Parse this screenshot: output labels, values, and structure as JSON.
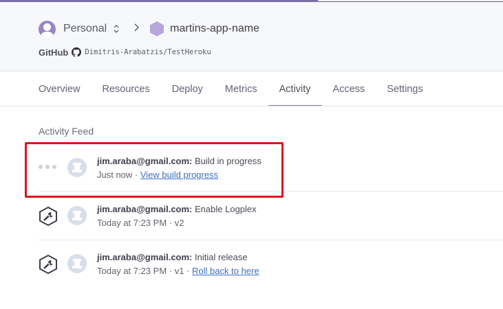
{
  "header": {
    "account": "Personal",
    "app_name": "martins-app-name",
    "github_label": "GitHub",
    "github_repo": "Dimitris-Arabatzis/TestHeroku"
  },
  "tabs": [
    {
      "label": "Overview"
    },
    {
      "label": "Resources"
    },
    {
      "label": "Deploy"
    },
    {
      "label": "Metrics"
    },
    {
      "label": "Activity",
      "active": true
    },
    {
      "label": "Access"
    },
    {
      "label": "Settings"
    }
  ],
  "feed": {
    "title": "Activity Feed",
    "items": [
      {
        "user": "jim.araba@gmail.com:",
        "action": "Build in progress",
        "time": "Just now",
        "separator": " · ",
        "link": "View build progress",
        "status": "in-progress"
      },
      {
        "user": "jim.araba@gmail.com:",
        "action": "Enable Logplex",
        "time": "Today at 7:23 PM",
        "separator": " · ",
        "version": "v2"
      },
      {
        "user": "jim.araba@gmail.com:",
        "action": "Initial release",
        "time": "Today at 7:23 PM",
        "separator": " · ",
        "version": "v1",
        "separator2": " · ",
        "link": "Roll back to here"
      }
    ]
  },
  "colors": {
    "accent": "#7d6fa3",
    "highlight": "#e0121e",
    "link": "#3b6fc3"
  },
  "icons": [
    "personal-avatar-icon",
    "updown-chevron-icon",
    "chevron-right-icon",
    "app-hexagon-icon",
    "github-icon",
    "loading-dots-icon",
    "wrench-hexagon-icon",
    "user-avatar-icon"
  ]
}
